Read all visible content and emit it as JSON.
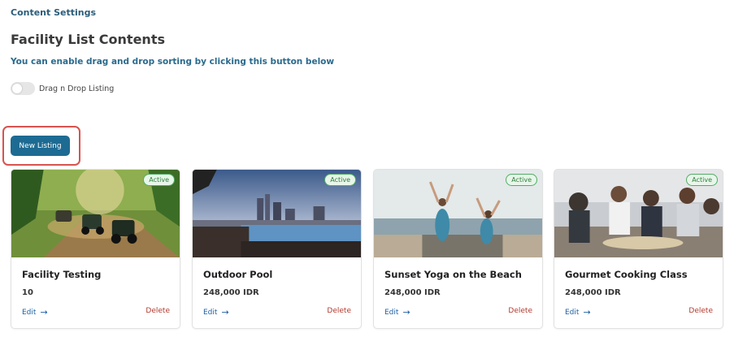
{
  "breadcrumb": "Content Settings",
  "page": {
    "title": "Facility List Contents",
    "subtitle": "You can enable drag and drop sorting by clicking this button below"
  },
  "toggle": {
    "label": "Drag n Drop Listing",
    "enabled": false
  },
  "new_listing_button": "New Listing",
  "cards": [
    {
      "title": "Facility Testing",
      "price": "10",
      "status": "Active",
      "edit_label": "Edit",
      "delete_label": "Delete",
      "image": "atv-jungle-photo"
    },
    {
      "title": "Outdoor Pool",
      "price": "248,000 IDR",
      "status": "Active",
      "edit_label": "Edit",
      "delete_label": "Delete",
      "image": "rooftop-pool-photo"
    },
    {
      "title": "Sunset Yoga on the Beach",
      "price": "248,000 IDR",
      "status": "Active",
      "edit_label": "Edit",
      "delete_label": "Delete",
      "image": "beach-yoga-photo"
    },
    {
      "title": "Gourmet Cooking Class",
      "price": "248,000 IDR",
      "status": "Active",
      "edit_label": "Edit",
      "delete_label": "Delete",
      "image": "cooking-class-photo"
    }
  ],
  "colors": {
    "primary_button": "#1d6b93",
    "highlight_border": "#d9534f",
    "active_badge": "#4fae63",
    "edit_link": "#1d5fa3",
    "delete_link": "#b23a2e"
  }
}
